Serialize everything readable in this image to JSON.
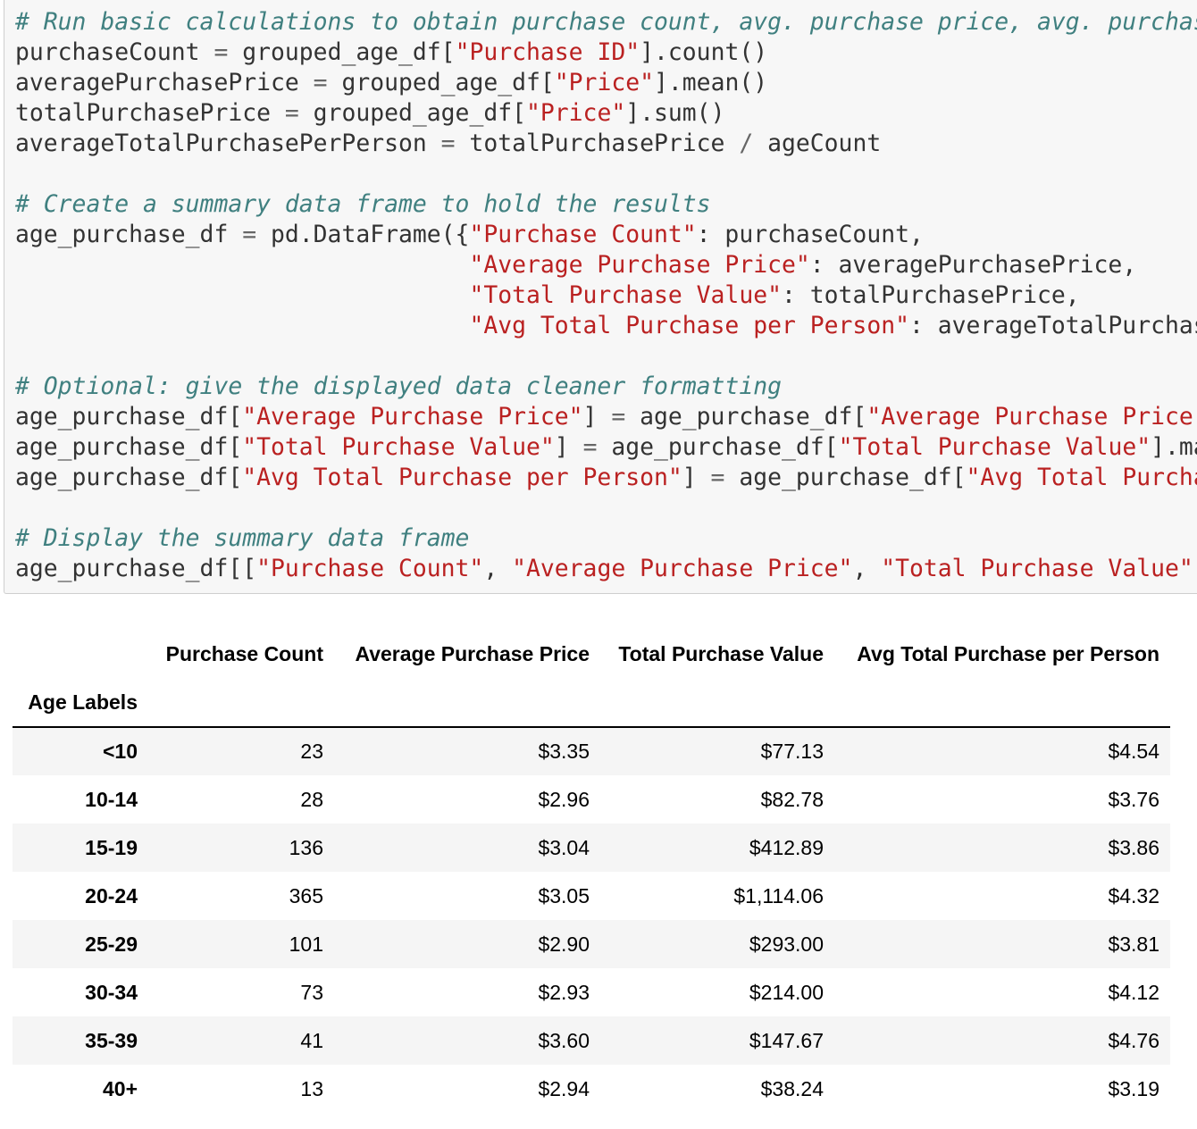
{
  "code_cell": {
    "lines": [
      [
        {
          "t": "comment",
          "v": "# Run basic calculations to obtain purchase count, avg. purchase price, avg. purchase total per person etc. in the table below"
        }
      ],
      [
        {
          "t": "",
          "v": "purchaseCount "
        },
        {
          "t": "op",
          "v": "="
        },
        {
          "t": "",
          "v": " grouped_age_df["
        },
        {
          "t": "str",
          "v": "\"Purchase ID\""
        },
        {
          "t": "",
          "v": "].count()"
        }
      ],
      [
        {
          "t": "",
          "v": "averagePurchasePrice "
        },
        {
          "t": "op",
          "v": "="
        },
        {
          "t": "",
          "v": " grouped_age_df["
        },
        {
          "t": "str",
          "v": "\"Price\""
        },
        {
          "t": "",
          "v": "].mean()"
        }
      ],
      [
        {
          "t": "",
          "v": "totalPurchasePrice "
        },
        {
          "t": "op",
          "v": "="
        },
        {
          "t": "",
          "v": " grouped_age_df["
        },
        {
          "t": "str",
          "v": "\"Price\""
        },
        {
          "t": "",
          "v": "].sum()"
        }
      ],
      [
        {
          "t": "",
          "v": "averageTotalPurchasePerPerson "
        },
        {
          "t": "op",
          "v": "="
        },
        {
          "t": "",
          "v": " totalPurchasePrice "
        },
        {
          "t": "op",
          "v": "/"
        },
        {
          "t": "",
          "v": " ageCount"
        }
      ],
      [],
      [
        {
          "t": "comment",
          "v": "# Create a summary data frame to hold the results"
        }
      ],
      [
        {
          "t": "",
          "v": "age_purchase_df "
        },
        {
          "t": "op",
          "v": "="
        },
        {
          "t": "",
          "v": " pd.DataFrame({"
        },
        {
          "t": "str",
          "v": "\"Purchase Count\""
        },
        {
          "t": "",
          "v": ": purchaseCount,"
        }
      ],
      [
        {
          "t": "",
          "v": "                                "
        },
        {
          "t": "str",
          "v": "\"Average Purchase Price\""
        },
        {
          "t": "",
          "v": ": averagePurchasePrice,"
        }
      ],
      [
        {
          "t": "",
          "v": "                                "
        },
        {
          "t": "str",
          "v": "\"Total Purchase Value\""
        },
        {
          "t": "",
          "v": ": totalPurchasePrice,"
        }
      ],
      [
        {
          "t": "",
          "v": "                                "
        },
        {
          "t": "str",
          "v": "\"Avg Total Purchase per Person\""
        },
        {
          "t": "",
          "v": ": averageTotalPurchasePerPerson})"
        }
      ],
      [],
      [
        {
          "t": "comment",
          "v": "# Optional: give the displayed data cleaner formatting"
        }
      ],
      [
        {
          "t": "",
          "v": "age_purchase_df["
        },
        {
          "t": "str",
          "v": "\"Average Purchase Price\""
        },
        {
          "t": "",
          "v": "] "
        },
        {
          "t": "op",
          "v": "="
        },
        {
          "t": "",
          "v": " age_purchase_df["
        },
        {
          "t": "str",
          "v": "\"Average Purchase Price\""
        },
        {
          "t": "",
          "v": "].map(\"${:.2f}\".format)"
        }
      ],
      [
        {
          "t": "",
          "v": "age_purchase_df["
        },
        {
          "t": "str",
          "v": "\"Total Purchase Value\""
        },
        {
          "t": "",
          "v": "] "
        },
        {
          "t": "op",
          "v": "="
        },
        {
          "t": "",
          "v": " age_purchase_df["
        },
        {
          "t": "str",
          "v": "\"Total Purchase Value\""
        },
        {
          "t": "",
          "v": "].map(\"${:,.2f}\".format)"
        }
      ],
      [
        {
          "t": "",
          "v": "age_purchase_df["
        },
        {
          "t": "str",
          "v": "\"Avg Total Purchase per Person\""
        },
        {
          "t": "",
          "v": "] "
        },
        {
          "t": "op",
          "v": "="
        },
        {
          "t": "",
          "v": " age_purchase_df["
        },
        {
          "t": "str",
          "v": "\"Avg Total Purchase per Person\""
        },
        {
          "t": "",
          "v": "].map(\"${:.2f}\".format)"
        }
      ],
      [],
      [
        {
          "t": "comment",
          "v": "# Display the summary data frame"
        }
      ],
      [
        {
          "t": "",
          "v": "age_purchase_df[["
        },
        {
          "t": "str",
          "v": "\"Purchase Count\""
        },
        {
          "t": "",
          "v": ", "
        },
        {
          "t": "str",
          "v": "\"Average Purchase Price\""
        },
        {
          "t": "",
          "v": ", "
        },
        {
          "t": "str",
          "v": "\"Total Purchase Value\""
        },
        {
          "t": "",
          "v": ", "
        },
        {
          "t": "str",
          "v": "\"Avg Total Purchase per Person\""
        },
        {
          "t": "",
          "v": "]]"
        }
      ]
    ]
  },
  "output_table": {
    "columns": [
      "Purchase Count",
      "Average Purchase Price",
      "Total Purchase Value",
      "Avg Total Purchase per Person"
    ],
    "index_name": "Age Labels",
    "rows": [
      {
        "label": "<10",
        "cells": [
          "23",
          "$3.35",
          "$77.13",
          "$4.54"
        ]
      },
      {
        "label": "10-14",
        "cells": [
          "28",
          "$2.96",
          "$82.78",
          "$3.76"
        ]
      },
      {
        "label": "15-19",
        "cells": [
          "136",
          "$3.04",
          "$412.89",
          "$3.86"
        ]
      },
      {
        "label": "20-24",
        "cells": [
          "365",
          "$3.05",
          "$1,114.06",
          "$4.32"
        ]
      },
      {
        "label": "25-29",
        "cells": [
          "101",
          "$2.90",
          "$293.00",
          "$3.81"
        ]
      },
      {
        "label": "30-34",
        "cells": [
          "73",
          "$2.93",
          "$214.00",
          "$4.12"
        ]
      },
      {
        "label": "35-39",
        "cells": [
          "41",
          "$3.60",
          "$147.67",
          "$4.76"
        ]
      },
      {
        "label": "40+",
        "cells": [
          "13",
          "$2.94",
          "$38.24",
          "$3.19"
        ]
      }
    ]
  }
}
